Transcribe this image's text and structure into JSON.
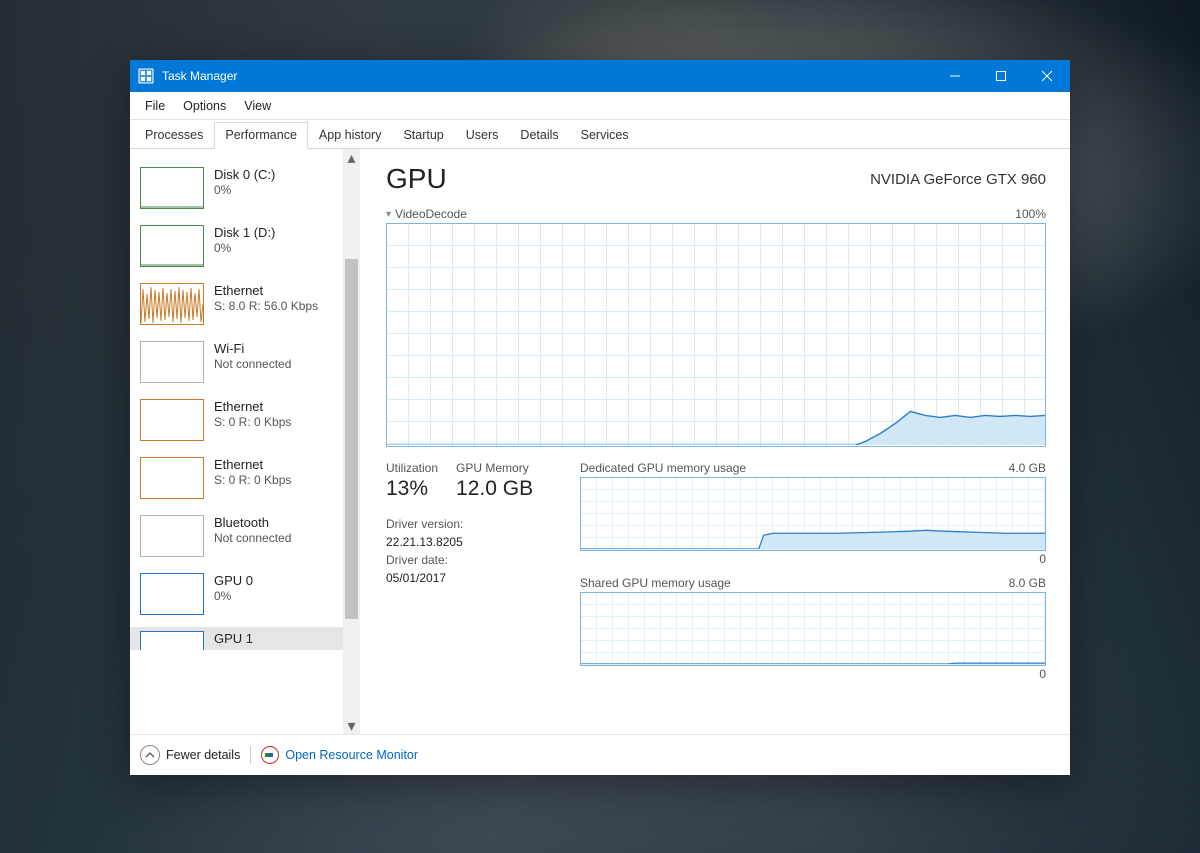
{
  "titlebar": {
    "title": "Task Manager"
  },
  "menu": {
    "file": "File",
    "options": "Options",
    "view": "View"
  },
  "tabs": {
    "processes": "Processes",
    "performance": "Performance",
    "app_history": "App history",
    "startup": "Startup",
    "users": "Users",
    "details": "Details",
    "services": "Services"
  },
  "sidebar": {
    "items": [
      {
        "title": "Disk 0 (C:)",
        "sub": "0%",
        "style": "green"
      },
      {
        "title": "Disk 1 (D:)",
        "sub": "0%",
        "style": "green"
      },
      {
        "title": "Ethernet",
        "sub": "S: 8.0 R: 56.0 Kbps",
        "style": "orange"
      },
      {
        "title": "Wi-Fi",
        "sub": "Not connected",
        "style": "grey"
      },
      {
        "title": "Ethernet",
        "sub": "S: 0 R: 0 Kbps",
        "style": "orange"
      },
      {
        "title": "Ethernet",
        "sub": "S: 0 R: 0 Kbps",
        "style": "orange"
      },
      {
        "title": "Bluetooth",
        "sub": "Not connected",
        "style": "grey"
      },
      {
        "title": "GPU 0",
        "sub": "0%",
        "style": "blue"
      },
      {
        "title": "GPU 1",
        "sub": "",
        "style": "blue"
      }
    ]
  },
  "main": {
    "heading": "GPU",
    "device": "NVIDIA GeForce GTX 960",
    "video_decode": {
      "label": "VideoDecode",
      "max": "100%"
    },
    "utilization": {
      "label": "Utilization",
      "value": "13%"
    },
    "gpu_memory": {
      "label": "GPU Memory",
      "value": "12.0 GB"
    },
    "driver_version": {
      "label": "Driver version:",
      "value": "22.21.13.8205"
    },
    "driver_date": {
      "label": "Driver date:",
      "value": "05/01/2017"
    },
    "dedicated": {
      "label": "Dedicated GPU memory usage",
      "max": "4.0 GB",
      "floor": "0"
    },
    "shared": {
      "label": "Shared GPU memory usage",
      "max": "8.0 GB",
      "floor": "0"
    }
  },
  "statusbar": {
    "fewer": "Fewer details",
    "open_rm": "Open Resource Monitor"
  },
  "chart_data": [
    {
      "type": "line",
      "title": "VideoDecode",
      "ylim": [
        0,
        100
      ],
      "ylabel": "%",
      "series": [
        {
          "name": "VideoDecode",
          "values": [
            0,
            0,
            0,
            0,
            0,
            0,
            0,
            0,
            0,
            0,
            0,
            0,
            0,
            0,
            0,
            0,
            0,
            0,
            0,
            0,
            0,
            0,
            0,
            0,
            0,
            0,
            0,
            3,
            6,
            8,
            12,
            15,
            13,
            12,
            13,
            12,
            13,
            13,
            13
          ]
        }
      ]
    },
    {
      "type": "line",
      "title": "Dedicated GPU memory usage",
      "ylim": [
        0,
        4
      ],
      "ylabel": "GB",
      "series": [
        {
          "name": "Dedicated",
          "values": [
            0,
            0,
            0,
            0,
            0,
            0,
            0,
            0,
            0,
            0,
            0,
            0,
            0,
            0,
            0.7,
            0.75,
            0.8,
            0.8,
            0.8,
            0.8,
            0.82,
            0.85,
            0.85,
            0.83,
            0.82,
            0.8,
            0.8,
            0.8,
            0.8,
            0.8
          ]
        }
      ]
    },
    {
      "type": "line",
      "title": "Shared GPU memory usage",
      "ylim": [
        0,
        8
      ],
      "ylabel": "GB",
      "series": [
        {
          "name": "Shared",
          "values": [
            0,
            0,
            0,
            0,
            0,
            0,
            0,
            0,
            0,
            0,
            0,
            0,
            0,
            0,
            0,
            0,
            0,
            0,
            0,
            0,
            0,
            0,
            0,
            0,
            0,
            0.02,
            0.03,
            0.03,
            0.03,
            0.03
          ]
        }
      ]
    }
  ]
}
